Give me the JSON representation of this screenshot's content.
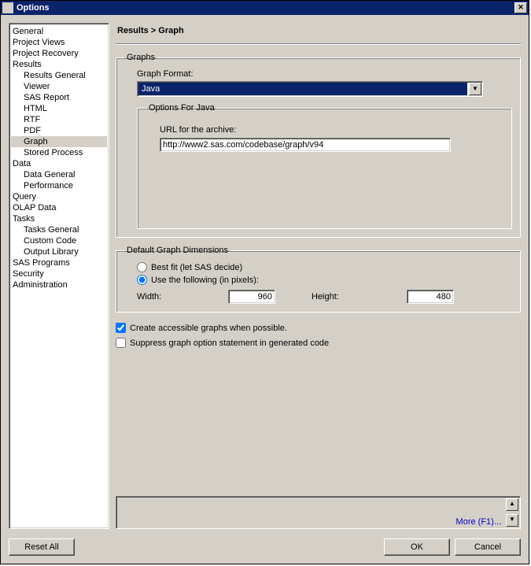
{
  "window": {
    "title": "Options"
  },
  "tree": {
    "items": [
      {
        "label": "General",
        "child": false
      },
      {
        "label": "Project Views",
        "child": false
      },
      {
        "label": "Project Recovery",
        "child": false
      },
      {
        "label": "Results",
        "child": false
      },
      {
        "label": "Results General",
        "child": true
      },
      {
        "label": "Viewer",
        "child": true
      },
      {
        "label": "SAS Report",
        "child": true
      },
      {
        "label": "HTML",
        "child": true
      },
      {
        "label": "RTF",
        "child": true
      },
      {
        "label": "PDF",
        "child": true
      },
      {
        "label": "Graph",
        "child": true,
        "selected": true
      },
      {
        "label": "Stored Process",
        "child": true
      },
      {
        "label": "Data",
        "child": false
      },
      {
        "label": "Data General",
        "child": true
      },
      {
        "label": "Performance",
        "child": true
      },
      {
        "label": "Query",
        "child": false
      },
      {
        "label": "OLAP Data",
        "child": false
      },
      {
        "label": "Tasks",
        "child": false
      },
      {
        "label": "Tasks General",
        "child": true
      },
      {
        "label": "Custom Code",
        "child": true
      },
      {
        "label": "Output Library",
        "child": true
      },
      {
        "label": "SAS Programs",
        "child": false
      },
      {
        "label": "Security",
        "child": false
      },
      {
        "label": "Administration",
        "child": false
      }
    ]
  },
  "breadcrumb": "Results > Graph",
  "graphs": {
    "legend": "Graphs",
    "format_label": "Graph Format:",
    "format_value": "Java",
    "options_for": "Options For Java",
    "url_label": "URL for the archive:",
    "url_value": "http://www2.sas.com/codebase/graph/v94"
  },
  "dims": {
    "legend": "Default Graph Dimensions",
    "best_fit": "Best fit (let SAS decide)",
    "use_following": "Use the following (in pixels):",
    "width_label": "Width:",
    "width_value": "960",
    "height_label": "Height:",
    "height_value": "480"
  },
  "checks": {
    "accessible": "Create accessible graphs when possible.",
    "suppress": "Suppress graph option statement in generated code"
  },
  "more": "More (F1)...",
  "buttons": {
    "reset": "Reset All",
    "ok": "OK",
    "cancel": "Cancel"
  }
}
